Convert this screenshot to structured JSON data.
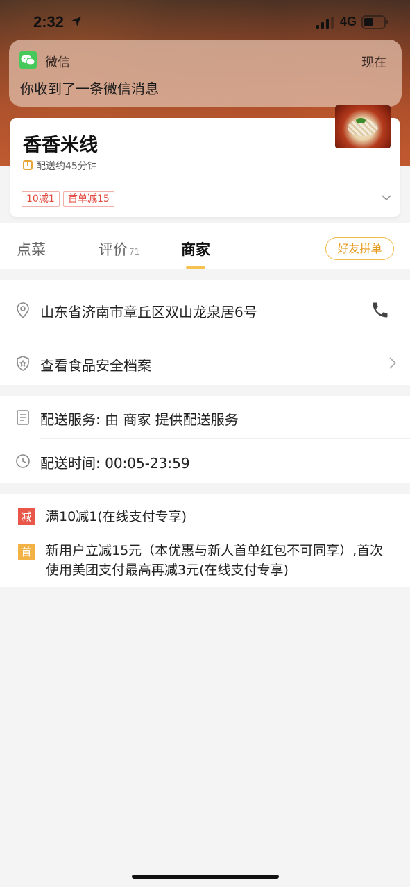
{
  "status_bar": {
    "time": "2:32",
    "network": "4G"
  },
  "notification": {
    "app_name": "微信",
    "time": "现在",
    "message": "你收到了一条微信消息"
  },
  "store": {
    "name": "香香米线",
    "delivery_time": "配送约45分钟",
    "promos": [
      "10减1",
      "首单减15"
    ]
  },
  "tabs": {
    "order": "点菜",
    "reviews": "评价",
    "reviews_count": "71",
    "merchant": "商家",
    "group_order": "好友拼单"
  },
  "merchant_info": {
    "address": "山东省济南市章丘区双山龙泉居6号",
    "food_safety": "查看食品安全档案",
    "delivery_service": "配送服务: 由 商家 提供配送服务",
    "delivery_hours": "配送时间:  00:05-23:59"
  },
  "discounts": [
    {
      "badge": "减",
      "color": "#e8574a",
      "text": "满10减1(在线支付专享)"
    },
    {
      "badge": "首",
      "color": "#f2b245",
      "text": "新用户立减15元（本优惠与新人首单红包不可同享）,首次使用美团支付最高再减3元(在线支付专享)"
    }
  ]
}
